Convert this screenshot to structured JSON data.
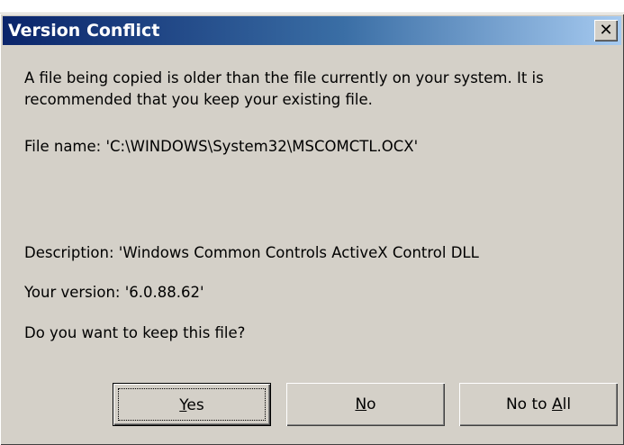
{
  "dialog": {
    "title": "Version Conflict",
    "close_glyph": "✕",
    "message": "A file being copied is older than the file currently on your system.  It is recommended that you keep your existing file.",
    "file_name_line": "File name:   'C:\\WINDOWS\\System32\\MSCOMCTL.OCX'",
    "description_line": "Description:  'Windows Common Controls ActiveX Control DLL",
    "version_line": "Your version: '6.0.88.62'",
    "question": "Do you want to keep this file?"
  },
  "buttons": {
    "yes": {
      "accel": "Y",
      "rest": "es"
    },
    "no": {
      "accel": "N",
      "rest": "o"
    },
    "no_to_all": {
      "pre": "No to ",
      "accel": "A",
      "rest": "ll"
    }
  }
}
